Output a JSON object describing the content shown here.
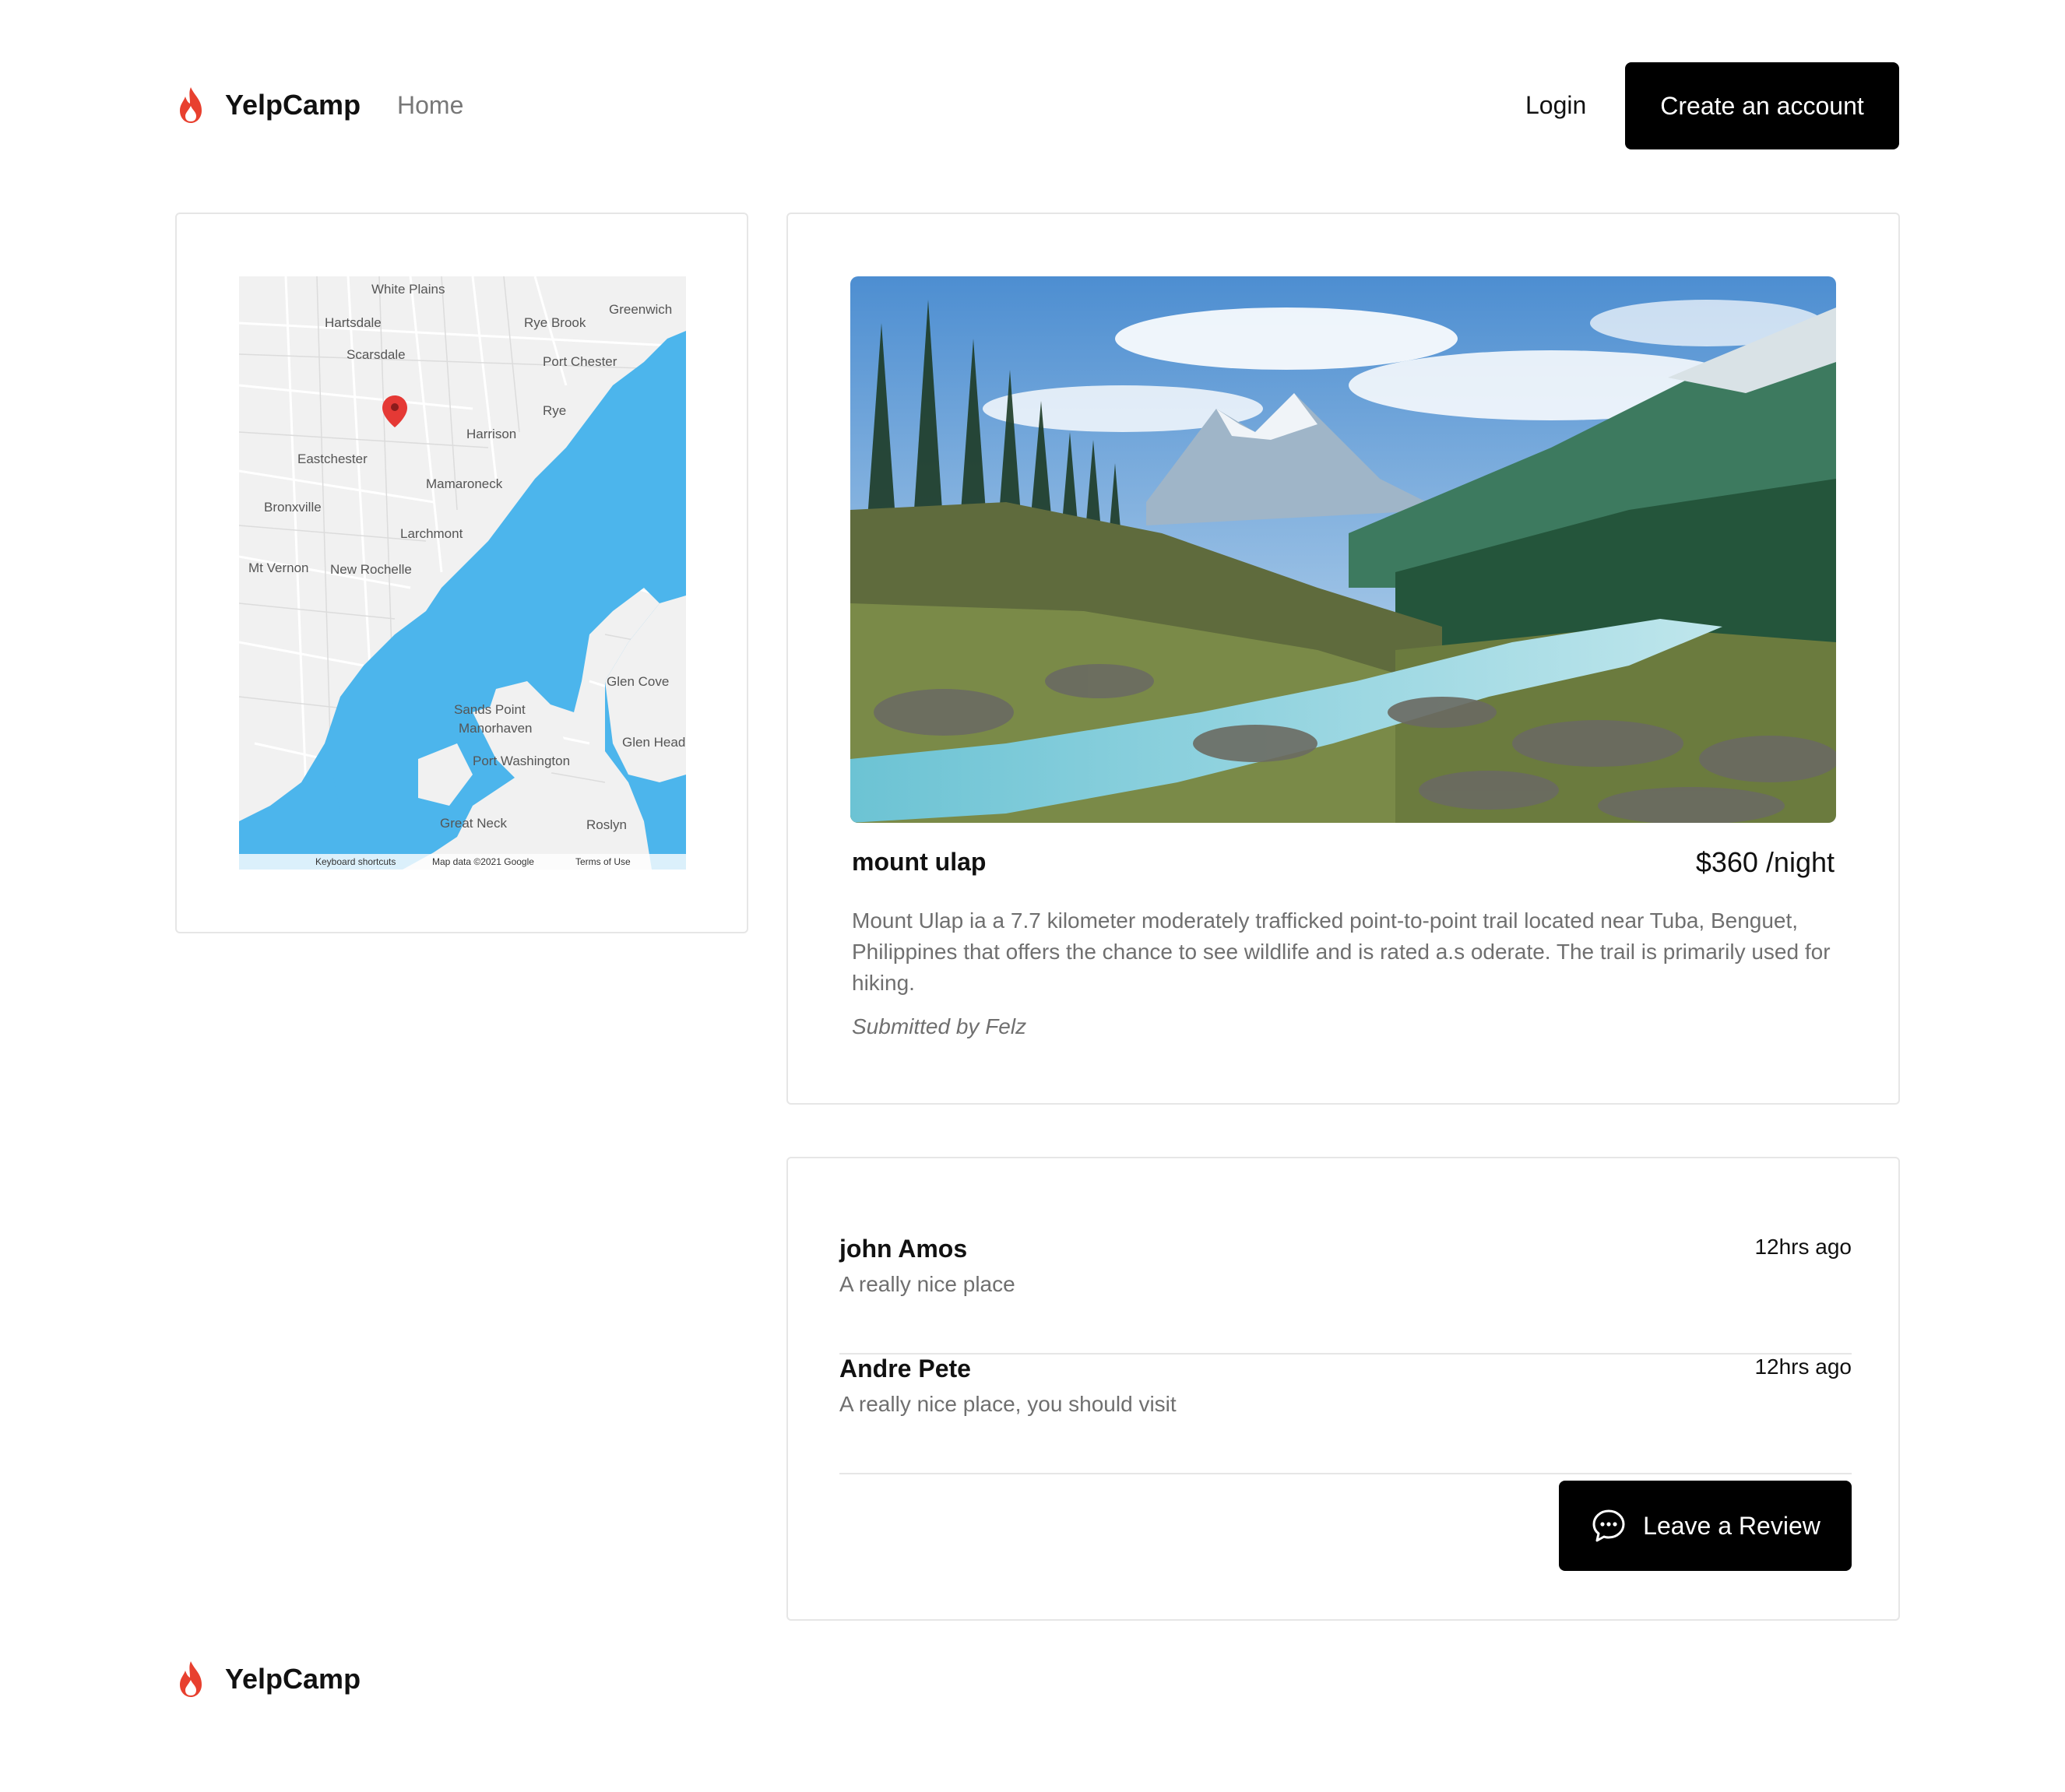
{
  "header": {
    "brand": "YelpCamp",
    "nav_home": "Home",
    "login": "Login",
    "create_account": "Create an account"
  },
  "map": {
    "labels": [
      "White Plains",
      "Greenwich",
      "Hartsdale",
      "Rye Brook",
      "Scarsdale",
      "Port Chester",
      "Rye",
      "Harrison",
      "Eastchester",
      "Mamaroneck",
      "Bronxville",
      "Larchmont",
      "Mt Vernon",
      "New Rochelle",
      "Glen Cove",
      "Sands Point",
      "Manorhaven",
      "Port Washington",
      "Glen Head",
      "Great Neck",
      "Roslyn"
    ],
    "attribution": [
      "Keyboard shortcuts",
      "Map data ©2021 Google",
      "Terms of Use"
    ]
  },
  "campground": {
    "title": "mount ulap",
    "price": "$360 /night",
    "description": "Mount Ulap ia a 7.7 kilometer moderately trafficked point-to-point trail located near Tuba, Benguet, Philippines that offers the chance to see wildlife and is rated a.s oderate. The trail is primarily used for hiking.",
    "submitted_by": "Submitted by Felz"
  },
  "reviews": [
    {
      "author": "john Amos",
      "text": "A really nice place",
      "time": "12hrs ago"
    },
    {
      "author": "Andre Pete",
      "text": "A really nice place, you should visit",
      "time": "12hrs ago"
    }
  ],
  "leave_review": "Leave a Review",
  "footer": {
    "brand": "YelpCamp"
  },
  "colors": {
    "flame": "#e8402f",
    "water": "#4cb5ec",
    "button": "#000000"
  }
}
